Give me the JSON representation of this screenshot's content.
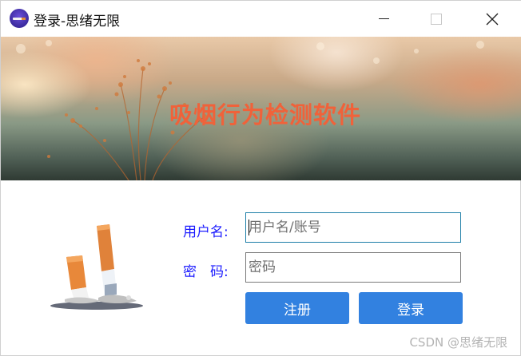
{
  "window": {
    "title": "登录-思绪无限",
    "controls": {
      "minimize_icon": "minimize-icon",
      "maximize_icon": "maximize-icon",
      "close_icon": "close-icon"
    }
  },
  "banner": {
    "title": "吸烟行为检测软件",
    "title_color": "#f0623a"
  },
  "form": {
    "username_label": "用户名:",
    "username_placeholder": "用户名/账号",
    "username_value": "",
    "password_label": "密　码:",
    "password_placeholder": "密码",
    "password_value": ""
  },
  "buttons": {
    "register_label": "注册",
    "login_label": "登录",
    "color": "#3281e0"
  },
  "watermark": "CSDN @思绪无限",
  "icons": {
    "app": "cigarette-app-icon",
    "illustration": "cigarette-butts-illustration"
  }
}
